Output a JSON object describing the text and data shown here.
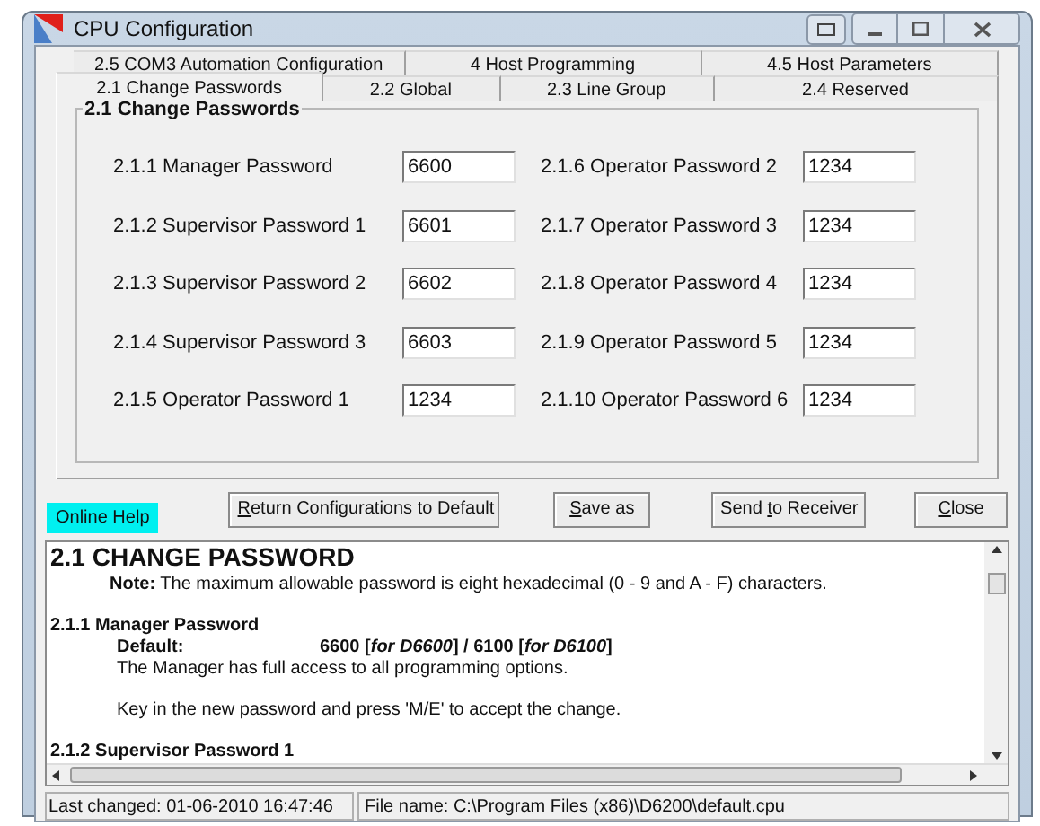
{
  "window": {
    "title": "CPU Configuration"
  },
  "tab_rows": [
    [
      {
        "label": "2.5 COM3 Automation Configuration",
        "selected": false
      },
      {
        "label": "4 Host Programming",
        "selected": false
      },
      {
        "label": "4.5  Host Parameters",
        "selected": false
      }
    ],
    [
      {
        "label": "2.1 Change Passwords",
        "selected": true
      },
      {
        "label": "2.2 Global",
        "selected": false
      },
      {
        "label": "2.3 Line Group",
        "selected": false
      },
      {
        "label": "2.4 Reserved",
        "selected": false
      }
    ]
  ],
  "group": {
    "title": "2.1 Change Passwords",
    "fields": [
      {
        "label": "2.1.1 Manager Password",
        "value": "6600"
      },
      {
        "label": "2.1.6 Operator Password 2",
        "value": "1234"
      },
      {
        "label": "2.1.2 Supervisor Password  1",
        "value": "6601"
      },
      {
        "label": "2.1.7 Operator Password 3",
        "value": "1234"
      },
      {
        "label": "2.1.3 Supervisor Password  2",
        "value": "6602"
      },
      {
        "label": "2.1.8 Operator Password 4",
        "value": "1234"
      },
      {
        "label": "2.1.4 Supervisor Password  3",
        "value": "6603"
      },
      {
        "label": "2.1.9 Operator Password 5",
        "value": "1234"
      },
      {
        "label": "2.1.5 Operator Password 1",
        "value": "1234"
      },
      {
        "label": "2.1.10 Operator Password 6",
        "value": "1234"
      }
    ]
  },
  "online_help": "Online Help",
  "buttons": [
    {
      "access_key": "R",
      "after": "eturn Configurations to Default"
    },
    {
      "access_key": "S",
      "after": "ave as"
    },
    {
      "before": "Send ",
      "access_key": "t",
      "after": "o Receiver"
    },
    {
      "access_key": "C",
      "after": "lose"
    }
  ],
  "help": {
    "title": "2.1 CHANGE PASSWORD",
    "blocks": [
      {
        "kind": "note",
        "text": "**Note:** The maximum allowable password is eight hexadecimal (0 - 9 and A - F) characters."
      },
      {
        "kind": "subheading",
        "text": "2.1.1 Manager Password"
      },
      {
        "kind": "default",
        "label": "Default:",
        "value": "6600 [*for D6600*] / 6100 [*for D6100*]"
      },
      {
        "kind": "para",
        "text": "The Manager has full access to all programming options."
      },
      {
        "kind": "para",
        "text": "Key in the new password and press 'M/E' to accept the change."
      },
      {
        "kind": "subheading",
        "text": "2.1.2 Supervisor Password 1"
      }
    ]
  },
  "status_bar": [
    "Last changed: 01-06-2010 16:47:46",
    "File name: C:\\Program Files (x86)\\D6200\\default.cpu"
  ]
}
